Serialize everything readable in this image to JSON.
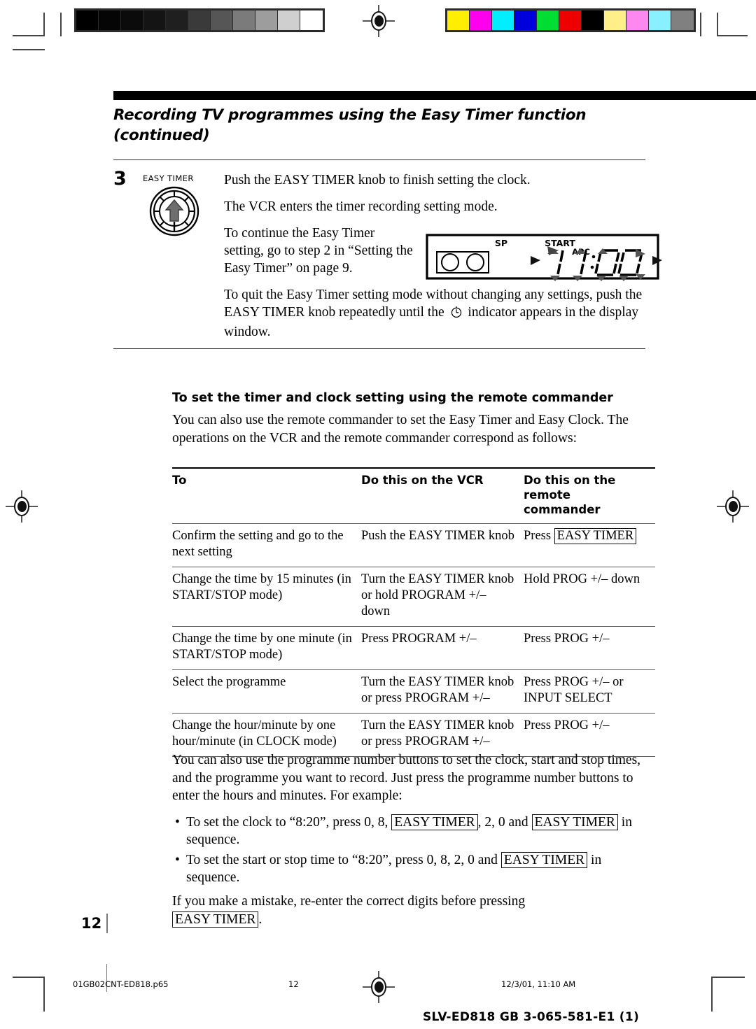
{
  "calibration": {
    "grey_swatches": [
      "#000000",
      "#050505",
      "#0b0b0b",
      "#141414",
      "#1f1f1f",
      "#3a3a3a",
      "#565656",
      "#7b7b7b",
      "#9d9d9d",
      "#cfcfcf",
      "#ffffff"
    ],
    "color_swatches": [
      "#ffee00",
      "#ff00ee",
      "#00eeff",
      "#0000dd",
      "#00dd33",
      "#ee0000",
      "#000000",
      "#ffef88",
      "#ff88f0",
      "#88f0ff",
      "#808080"
    ]
  },
  "header": {
    "chapter_title": "Recording TV programmes using the Easy Timer function (continued)"
  },
  "step": {
    "number": "3",
    "knob_label": "EASY TIMER",
    "knob_icon": "rotary-knob-up-arrow-icon",
    "line1": "Push the EASY TIMER knob to finish setting the clock.",
    "line2": "The VCR enters the timer recording setting mode.",
    "line3": "To continue the Easy Timer setting, go to step 2 in “Setting the Easy Timer” on page 9.",
    "line4_a": "To quit the Easy Timer setting mode without changing any settings, push the EASY TIMER knob repeatedly until the",
    "line4_icon": "clock-timer-indicator-icon",
    "line4_b": "indicator appears in the display window."
  },
  "vcr_display": {
    "label_sp": "SP",
    "label_start": "START",
    "label_apc": "APC",
    "time": "11:00",
    "hours": "11",
    "minutes": "00",
    "separator": ":",
    "cassette_icon": "cassette-reels-icon",
    "blink_marker_icon": "blinking-arrow-icon"
  },
  "section": {
    "subheading": "To set the timer and clock setting using the remote commander",
    "intro": "You can also use the remote commander to set the Easy Timer and Easy Clock. The operations on the VCR and the remote commander correspond as follows:"
  },
  "table": {
    "columns": [
      "To",
      "Do this on the VCR",
      "Do this on the remote commander"
    ],
    "rows": [
      {
        "to": "Confirm the setting and go to the next setting",
        "vcr": "Push the EASY TIMER knob",
        "remote_prefix": "Press ",
        "remote_key": "EASY TIMER",
        "remote_suffix": ""
      },
      {
        "to": "Change the time by 15 minutes (in START/STOP mode)",
        "vcr": "Turn the EASY TIMER knob or hold PROGRAM +/– down",
        "remote_prefix": "Hold PROG +/– down",
        "remote_key": "",
        "remote_suffix": ""
      },
      {
        "to": "Change the time by one minute (in START/STOP mode)",
        "vcr": "Press PROGRAM +/–",
        "remote_prefix": "Press PROG +/–",
        "remote_key": "",
        "remote_suffix": ""
      },
      {
        "to": "Select the programme",
        "vcr": "Turn the EASY TIMER knob or press PROGRAM +/–",
        "remote_prefix": "Press PROG +/– or INPUT SELECT",
        "remote_key": "",
        "remote_suffix": ""
      },
      {
        "to": "Change the hour/minute by one hour/minute (in CLOCK mode)",
        "vcr": "Turn the EASY TIMER knob or press PROGRAM +/–",
        "remote_prefix": "Press PROG +/–",
        "remote_key": "",
        "remote_suffix": ""
      }
    ]
  },
  "outro": {
    "paragraph": "You can also use the programme number buttons to set the clock, start and stop times, and the programme you want to record. Just press the programme number buttons to enter the hours and minutes. For example:",
    "bullet1_a": "To set the clock to “8:20”, press 0, 8,",
    "bullet1_key1": "EASY TIMER",
    "bullet1_b": ", 2, 0 and",
    "bullet1_key2": "EASY TIMER",
    "bullet1_c": "in sequence.",
    "bullet2_a": "To set the start or stop time to “8:20”, press 0, 8, 2, 0 and",
    "bullet2_key1": "EASY TIMER",
    "bullet2_b": "in sequence.",
    "final_a": "If you make a mistake, re-enter the correct digits before pressing",
    "final_key": "EASY TIMER",
    "final_b": "."
  },
  "page": {
    "number": "12"
  },
  "footer": {
    "filename": "01GB02CNT-ED818.p65",
    "page": "12",
    "timestamp": "12/3/01, 11:10 AM",
    "model": "SLV-ED818 GB 3-065-581-E1 (1)"
  }
}
